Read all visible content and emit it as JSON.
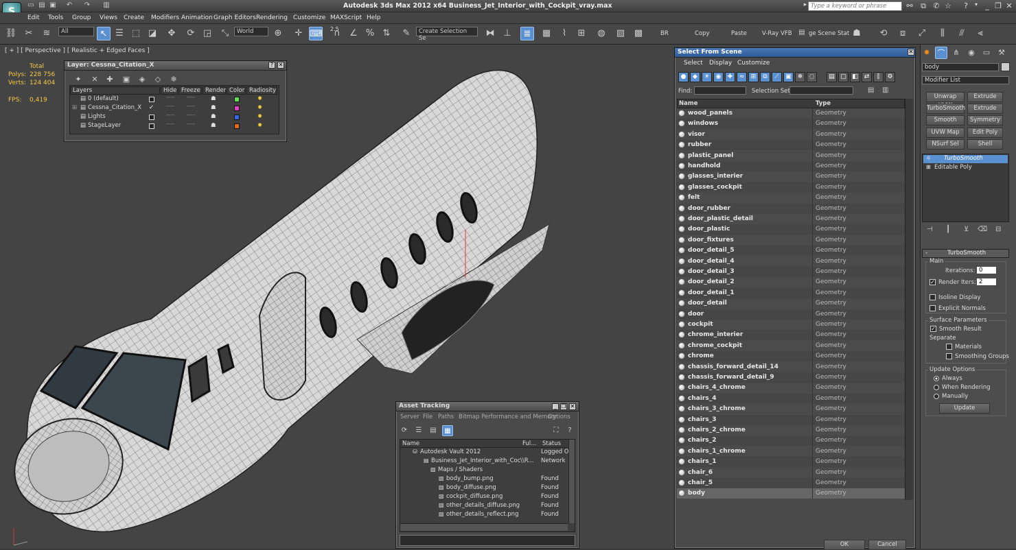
{
  "app": {
    "title": "Autodesk 3ds Max  2012 x64       Business_Jet_Interior_with_Cockpit_vray.max",
    "logo_letter": "S"
  },
  "search": {
    "placeholder": "Type a keyword or phrase"
  },
  "menu": [
    "Edit",
    "Tools",
    "Group",
    "Views",
    "Create",
    "Modifiers",
    "Animation",
    "Graph Editors",
    "Rendering",
    "Customize",
    "MAXScript",
    "Help"
  ],
  "toolbar": {
    "filter": "All",
    "coord": "World",
    "snap_value": "2.5",
    "create_selection_set": "Create Selection Se",
    "br_label": "BR",
    "copy_label": "Copy",
    "paste_label": "Paste",
    "vray_label": "V-Ray VFB",
    "scene_state_label": "ge Scene Stat"
  },
  "viewport": {
    "label": "[ + ] [ Perspective ] [ Realistic + Edged Faces ]",
    "stats": {
      "total_label": "Total",
      "polys_label": "Polys:",
      "polys": "228 756",
      "verts_label": "Verts:",
      "verts": "124 404",
      "fps_label": "FPS:",
      "fps": "0,419"
    }
  },
  "layer_panel": {
    "title": "Layer: Cessna_Citation_X",
    "columns": [
      "Layers",
      "Hide",
      "Freeze",
      "Render",
      "Color",
      "Radiosity"
    ],
    "rows": [
      {
        "name": "0 (default)",
        "checked": "",
        "color": "#66dd55"
      },
      {
        "name": "Cessna_Citation_X",
        "checked": "✓",
        "color": "#e040c0"
      },
      {
        "name": "Lights",
        "checked": "",
        "color": "#3a66e0"
      },
      {
        "name": "StageLayer",
        "checked": "",
        "color": "#e06a1a"
      }
    ]
  },
  "select_scene": {
    "title": "Select From Scene",
    "menu": [
      "Select",
      "Display",
      "Customize"
    ],
    "find_label": "Find:",
    "selection_set_label": "Selection Set:",
    "col_name": "Name",
    "col_type": "Type",
    "rows": [
      {
        "name": "wood_panels",
        "type": "Geometry"
      },
      {
        "name": "windows",
        "type": "Geometry"
      },
      {
        "name": "visor",
        "type": "Geometry"
      },
      {
        "name": "rubber",
        "type": "Geometry"
      },
      {
        "name": "plastic_panel",
        "type": "Geometry"
      },
      {
        "name": "handhold",
        "type": "Geometry"
      },
      {
        "name": "glasses_interier",
        "type": "Geometry"
      },
      {
        "name": "glasses_cockpit",
        "type": "Geometry"
      },
      {
        "name": "felt",
        "type": "Geometry"
      },
      {
        "name": "door_rubber",
        "type": "Geometry"
      },
      {
        "name": "door_plastic_detail",
        "type": "Geometry"
      },
      {
        "name": "door_plastic",
        "type": "Geometry"
      },
      {
        "name": "door_fixtures",
        "type": "Geometry"
      },
      {
        "name": "door_detail_5",
        "type": "Geometry"
      },
      {
        "name": "door_detail_4",
        "type": "Geometry"
      },
      {
        "name": "door_detail_3",
        "type": "Geometry"
      },
      {
        "name": "door_detail_2",
        "type": "Geometry"
      },
      {
        "name": "door_detail_1",
        "type": "Geometry"
      },
      {
        "name": "door_detail",
        "type": "Geometry"
      },
      {
        "name": "door",
        "type": "Geometry"
      },
      {
        "name": "cockpit",
        "type": "Geometry"
      },
      {
        "name": "chrome_interier",
        "type": "Geometry"
      },
      {
        "name": "chrome_cockpit",
        "type": "Geometry"
      },
      {
        "name": "chrome",
        "type": "Geometry"
      },
      {
        "name": "chassis_forward_detail_14",
        "type": "Geometry"
      },
      {
        "name": "chassis_forward_detail_9",
        "type": "Geometry"
      },
      {
        "name": "chairs_4_chrome",
        "type": "Geometry"
      },
      {
        "name": "chairs_4",
        "type": "Geometry"
      },
      {
        "name": "chairs_3_chrome",
        "type": "Geometry"
      },
      {
        "name": "chairs_3",
        "type": "Geometry"
      },
      {
        "name": "chairs_2_chrome",
        "type": "Geometry"
      },
      {
        "name": "chairs_2",
        "type": "Geometry"
      },
      {
        "name": "chairs_1_chrome",
        "type": "Geometry"
      },
      {
        "name": "chairs_1",
        "type": "Geometry"
      },
      {
        "name": "chair_6",
        "type": "Geometry"
      },
      {
        "name": "chair_5",
        "type": "Geometry"
      },
      {
        "name": "body",
        "type": "Geometry"
      }
    ],
    "ok_label": "OK",
    "cancel_label": "Cancel"
  },
  "command_panel": {
    "object_name": "body",
    "modifier_list": "Modifier List",
    "buttons": [
      "Unwrap UVW",
      "Extrude",
      "TurboSmooth",
      "Extrude",
      "Smooth",
      "Symmetry",
      "UVW Map",
      "Edit Poly",
      "NSurf Sel",
      "Shell"
    ],
    "stack": [
      "TurboSmooth",
      "Editable Poly"
    ],
    "rollout_title": "TurboSmooth",
    "main_label": "Main",
    "iterations_label": "Iterations:",
    "iterations": "0",
    "render_iters_label": "Render Iters:",
    "render_iters": "2",
    "isoline_label": "Isoline Display",
    "explicit_label": "Explicit Normals",
    "surface_label": "Surface Parameters",
    "smooth_result_label": "Smooth Result",
    "separate_label": "Separate",
    "materials_label": "Materials",
    "smoothing_groups_label": "Smoothing Groups",
    "update_options_label": "Update Options",
    "always_label": "Always",
    "when_rendering_label": "When Rendering",
    "manually_label": "Manually",
    "update_button": "Update"
  },
  "asset_tracking": {
    "title": "Asset Tracking",
    "menu": [
      "Server",
      "File",
      "Paths",
      "Bitmap Performance and Memory",
      "Options"
    ],
    "col_name": "Name",
    "col_full": "Ful...",
    "col_status": "Status",
    "rows": [
      {
        "name": "Autodesk Vault 2012",
        "full": "",
        "status": "Logged O"
      },
      {
        "name": "Business_Jet_Interior_with_Coc...",
        "full": "\\\\R...",
        "status": "Network"
      },
      {
        "name": "Maps / Shaders",
        "full": "",
        "status": ""
      },
      {
        "name": "body_bump.png",
        "full": "",
        "status": "Found"
      },
      {
        "name": "body_diffuse.png",
        "full": "",
        "status": "Found"
      },
      {
        "name": "cockpit_diffuse.png",
        "full": "",
        "status": "Found"
      },
      {
        "name": "other_details_diffuse.png",
        "full": "",
        "status": "Found"
      },
      {
        "name": "other_details_reflect.png",
        "full": "",
        "status": "Found"
      }
    ]
  }
}
